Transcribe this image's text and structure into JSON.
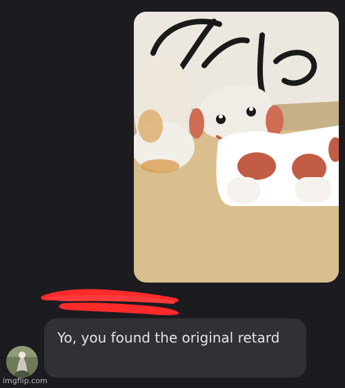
{
  "message": {
    "text": "Yo, you found the original retard"
  },
  "attachment": {
    "type": "image",
    "description": "porcelain dog figurines",
    "sign_text": "Ado"
  },
  "redaction": {
    "color": "#ff2b2b"
  },
  "avatar": {
    "icon": "avatar-icon"
  },
  "watermark": {
    "text": "imgflip.com"
  },
  "colors": {
    "background": "#1c1b20",
    "bubble": "#303135",
    "bubble_text": "#e6e4ea"
  }
}
